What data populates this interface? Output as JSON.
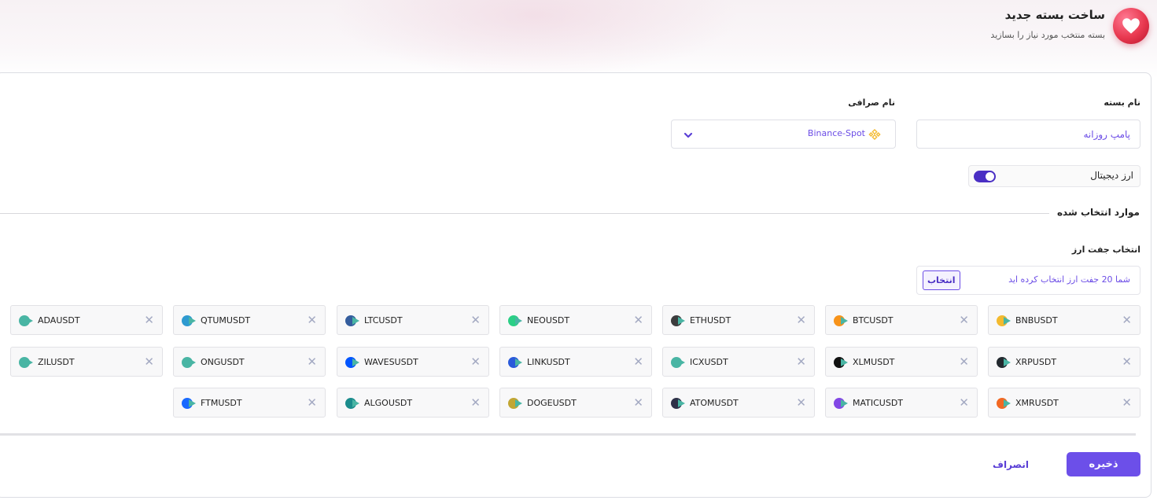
{
  "header": {
    "title": "ساخت بسته جدید",
    "subtitle": "بسته منتخب مورد نیاز را بسازید"
  },
  "form": {
    "package_name_label": "نام بسته",
    "package_name_value": "پامپ روزانه",
    "exchange_label": "نام صرافی",
    "exchange_value": "Binance-Spot",
    "crypto_toggle_label": "ارز دیجیتال",
    "crypto_toggle_on": true
  },
  "selected": {
    "section_title": "موارد انتخاب شده",
    "pair_label": "انتخاب جفت ارز",
    "pair_summary": "شما 20 جفت ارز انتخاب کرده اید",
    "pair_button": "انتخاب"
  },
  "chips": [
    {
      "label": "BNBUSDT",
      "icon": "bnb-coin-icon",
      "color": "#f3ba2f"
    },
    {
      "label": "BTCUSDT",
      "icon": "btc-coin-icon",
      "color": "#f7931a"
    },
    {
      "label": "ETHUSDT",
      "icon": "eth-coin-icon",
      "color": "#3c3c3d"
    },
    {
      "label": "NEOUSDT",
      "icon": "neo-coin-icon",
      "color": "#2bcf86"
    },
    {
      "label": "LTCUSDT",
      "icon": "ltc-coin-icon",
      "color": "#345d9d"
    },
    {
      "label": "QTUMUSDT",
      "icon": "qtum-coin-icon",
      "color": "#2e9ad0"
    },
    {
      "label": "ADAUSDT",
      "icon": "ada-coin-icon",
      "color": "#49b5a4"
    },
    {
      "label": "XRPUSDT",
      "icon": "xrp-coin-icon",
      "color": "#23292f"
    },
    {
      "label": "XLMUSDT",
      "icon": "xlm-coin-icon",
      "color": "#111111"
    },
    {
      "label": "ICXUSDT",
      "icon": "icx-coin-icon",
      "color": "#49b5a4"
    },
    {
      "label": "LINKUSDT",
      "icon": "link-coin-icon",
      "color": "#2a5ada"
    },
    {
      "label": "WAVESUSDT",
      "icon": "waves-coin-icon",
      "color": "#0155ff"
    },
    {
      "label": "ONGUSDT",
      "icon": "ong-coin-icon",
      "color": "#49b5a4"
    },
    {
      "label": "ZILUSDT",
      "icon": "zil-coin-icon",
      "color": "#49b5a4"
    },
    {
      "label": "XMRUSDT",
      "icon": "xmr-coin-icon",
      "color": "#f26822"
    },
    {
      "label": "MATICUSDT",
      "icon": "matic-coin-icon",
      "color": "#8247e5"
    },
    {
      "label": "ATOMUSDT",
      "icon": "atom-coin-icon",
      "color": "#2e3148"
    },
    {
      "label": "DOGEUSDT",
      "icon": "doge-coin-icon",
      "color": "#c2a633"
    },
    {
      "label": "ALGOUSDT",
      "icon": "algo-coin-icon",
      "color": "#1b8c8c"
    },
    {
      "label": "FTMUSDT",
      "icon": "ftm-coin-icon",
      "color": "#1969ff"
    }
  ],
  "chip_remove_symbol": "✕",
  "actions": {
    "save_label": "ذخیره",
    "cancel_label": "انصراف"
  },
  "colors": {
    "accent": "#6c4fe9",
    "toggle": "#4a2fc4",
    "brand_red": "#e8384f"
  }
}
